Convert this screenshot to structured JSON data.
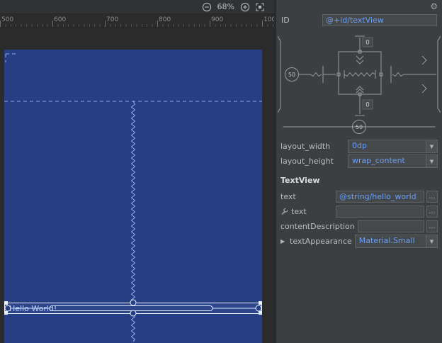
{
  "colors": {
    "panel_bg": "#3c3f41",
    "canvas_bg": "#2b2b2b",
    "blueprint_bg": "#253e84",
    "blueprint_line": "#9fbdf3",
    "value_text": "#6b9ef8",
    "field_bg": "#45494a",
    "field_border": "#5e6264",
    "label_text": "#bbbbbb"
  },
  "icons": {
    "gear": "⚙",
    "dropdown": "▼",
    "more": "…",
    "expander": "▶"
  },
  "toolbar": {
    "zoom_level": "68%"
  },
  "ruler": {
    "ticks": [
      "500",
      "600",
      "700",
      "800",
      "900",
      "100"
    ]
  },
  "canvas": {
    "widget_text": "Hello World!"
  },
  "attributes": {
    "id_label": "ID",
    "id_value": "@+id/textView",
    "constraint_widget": {
      "top_margin": "0",
      "bottom_margin": "0",
      "vertical_bias": "50",
      "horizontal_bias": "50"
    },
    "layout_rows": [
      {
        "label": "layout_width",
        "value": "0dp"
      },
      {
        "label": "layout_height",
        "value": "wrap_content"
      }
    ],
    "section_title": "TextView",
    "fields": [
      {
        "label": "text",
        "value": "@string/hello_world"
      },
      {
        "label": "text",
        "value": ""
      },
      {
        "label": "contentDescription",
        "value": ""
      },
      {
        "label": "textAppearance",
        "value": "Material.Small"
      }
    ]
  }
}
